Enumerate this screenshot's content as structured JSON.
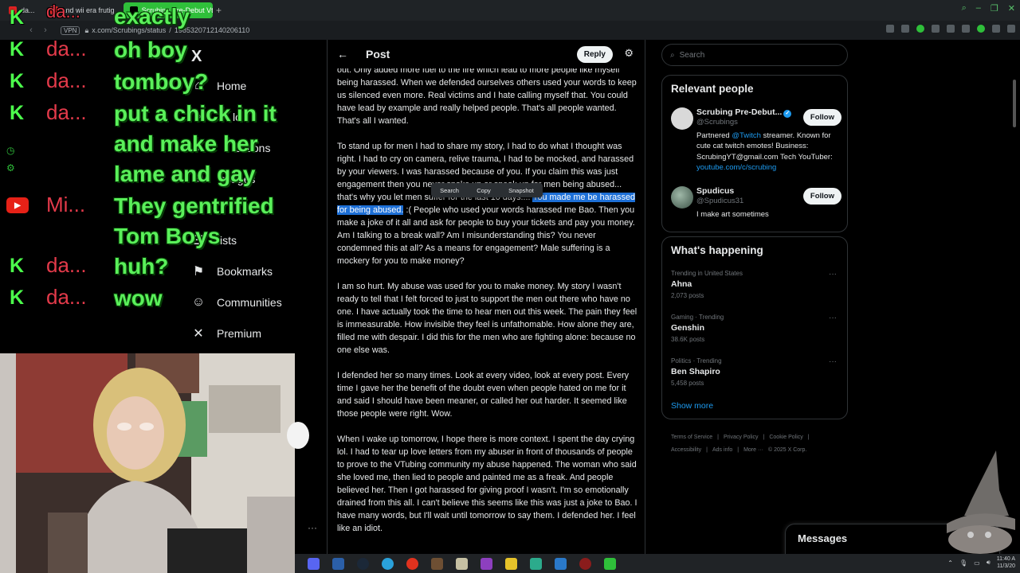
{
  "browser": {
    "tabs": [
      {
        "label": "da..."
      },
      {
        "label": "and wii era frutig"
      },
      {
        "label": "Scrubing Pre-Debut Vtub"
      }
    ],
    "url_prefix": "x.com/Scrubings/status",
    "url_suffix": "1985320712140206110",
    "vpn_label": "VPN"
  },
  "chat": {
    "rows": [
      {
        "badge": "K",
        "user": "da...",
        "message": "exactly"
      },
      {
        "badge": "K",
        "user": "da...",
        "message": "oh boy"
      },
      {
        "badge": "K",
        "user": "da...",
        "message": "tomboy?"
      },
      {
        "badge": "K",
        "user": "da...",
        "message": "put a chick in it"
      },
      {
        "badge": "",
        "user": "",
        "message": "and make her"
      },
      {
        "badge": "",
        "user": "",
        "message": "lame and gay"
      },
      {
        "badge": "YT",
        "user": "Mi...",
        "message": "They gentrified"
      },
      {
        "badge": "",
        "user": "",
        "message": "Tom Boys"
      },
      {
        "badge": "K",
        "user": "da...",
        "message": "huh?"
      },
      {
        "badge": "K",
        "user": "da...",
        "message": "wow"
      }
    ]
  },
  "xnav": {
    "logo": "X",
    "home": "Home",
    "explore_partial": "lo",
    "notifications_partial": "ications",
    "messages_partial": "ssages",
    "lists_partial": "ists",
    "bookmarks": "Bookmarks",
    "communities": "Communities",
    "premium": "Premium"
  },
  "feed": {
    "title": "Post",
    "reply_label": "Reply",
    "context_menu": [
      "Search",
      "Copy",
      "Snapshot"
    ],
    "p1": "out. Only added more fuel to the fire which lead to more people like myself being harassed. When we defended ourselves others used your words to keep us silenced even more. Real victims and I hate calling myself that. You could have lead by example and really helped people. That's all people wanted. That's all I wanted.",
    "p2_a": "To stand up for men I had to share my story, I had to do what I thought was right. I had to cry on camera, relive trauma, I had to be mocked, and harassed by your viewers. I was harassed because of you. If you claim this was just engagement then you never spoke up or speak up for men being abused... that's why you let men suffer for the last 10 days....",
    "p2_hl": "You made me be harassed for being abused.",
    "p2_b": ":( People who used your words harassed me Bao. Then you make a joke of it all and ask for people to buy your tickets and pay you money. Am I talking to a break wall? Am I misunderstanding this? You never condemned this at all? As a means for engagement? Male suffering is a mockery for you to make money?",
    "p3": "I am so hurt. My abuse was used for you to make money. My story I wasn't ready to tell that I felt forced to just to support the men out there who have no one. I have actually took the time to hear men out this week. The pain they feel is immeasurable. How invisible they feel is unfathomable. How alone they are, filled me with despair. I did this for the men who are fighting alone: because no one else was.",
    "p4": "I defended her so many times. Look at every video, look at every post. Every time I gave her the benefit of the doubt even when people hated on me for it and said I should have been meaner, or called her out harder. It seemed like those people were right. Wow.",
    "p5": "When I wake up tomorrow, I hope there is more context. I spent the day crying lol. I had to tear up love letters from my abuser in front of thousands of people to prove to the VTubing community my abuse happened. The woman who said she loved me, then lied to people and painted me as a freak. And people believed her. Then I got harassed for giving proof I wasn't. I'm so emotionally drained from this all. I can't believe this seems like this was just a joke to Bao. I have many words, but I'll wait until tomorrow to say them. I defended her. I feel like an idiot."
  },
  "sidebar": {
    "search_placeholder": "Search",
    "relevant_title": "Relevant people",
    "people": [
      {
        "name": "Scrubing Pre-Debut...",
        "handle": "@Scrubings",
        "bio_pre": "Partnered ",
        "bio_link": "@Twitch",
        "bio_mid": " streamer. Known for cute cat twitch emotes! Business: ScrubingYT@gmail.com Tech YouTuber: ",
        "bio_link2": "youtube.com/c/scrubing",
        "follow": "Follow"
      },
      {
        "name": "Spudicus",
        "handle": "@Spudicus31",
        "bio_pre": "I make art sometimes",
        "bio_link": "",
        "bio_mid": "",
        "bio_link2": "",
        "follow": "Follow"
      }
    ],
    "happening_title": "What's happening",
    "trends": [
      {
        "meta": "Trending in United States",
        "name": "Ahna",
        "count": "2,073 posts"
      },
      {
        "meta": "Gaming · Trending",
        "name": "Genshin",
        "count": "38.6K posts"
      },
      {
        "meta": "Politics · Trending",
        "name": "Ben Shapiro",
        "count": "5,458 posts"
      }
    ],
    "show_more": "Show more",
    "footer": [
      "Terms of Service",
      "|",
      "Privacy Policy",
      "|",
      "Cookie Policy",
      "|",
      "Accessibility",
      "|",
      "Ads info",
      "|",
      "More ···",
      "© 2025 X Corp."
    ]
  },
  "messages_label": "Messages",
  "taskbar": {
    "time": "11:40 A",
    "date": "11/3/20"
  },
  "colors": {
    "accent": "#1d9bf0",
    "chat_name": "#e33a4a",
    "chat_text": "#5af05a",
    "highlight": "#1d6fd6",
    "tab_active": "#2fbf3a"
  }
}
